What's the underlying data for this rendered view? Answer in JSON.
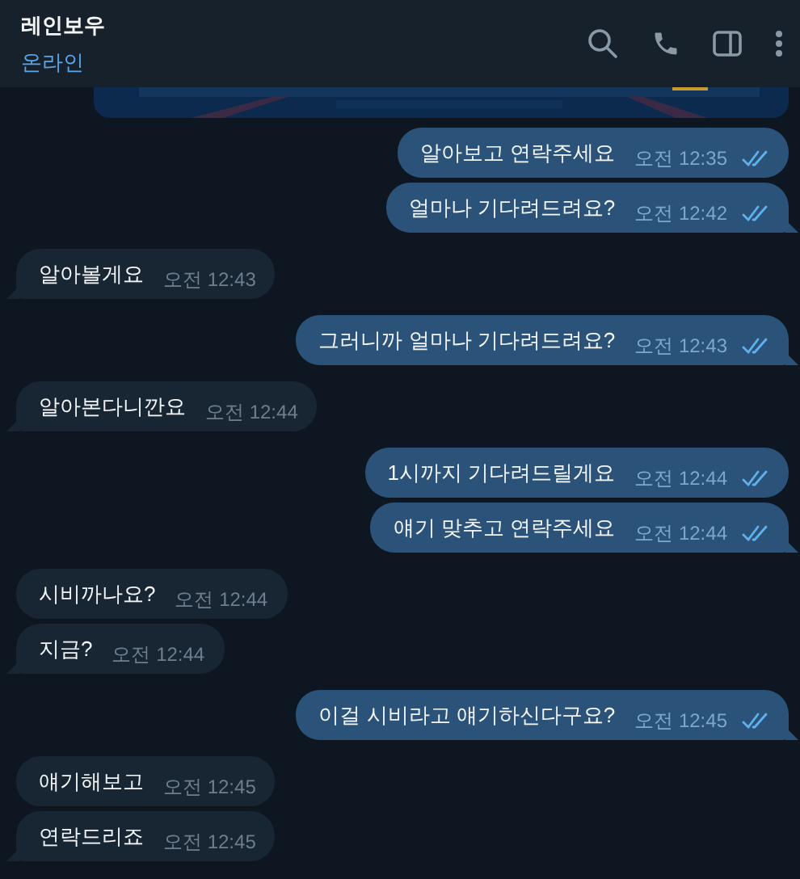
{
  "chat": {
    "title": "레인보우",
    "status": "온라인"
  },
  "messages": [
    {
      "kind": "out",
      "text": "알아보고 연락주세요",
      "time": "오전 12:35",
      "read": true
    },
    {
      "kind": "out",
      "text": "얼마나 기다려드려요?",
      "time": "오전 12:42",
      "read": true
    },
    {
      "kind": "in",
      "text": "알아볼게요",
      "time": "오전 12:43"
    },
    {
      "kind": "out",
      "text": "그러니까 얼마나 기다려드려요?",
      "time": "오전 12:43",
      "read": true
    },
    {
      "kind": "in",
      "text": "알아본다니깐요",
      "time": "오전 12:44"
    },
    {
      "kind": "out",
      "text": "1시까지 기다려드릴게요",
      "time": "오전 12:44",
      "read": true
    },
    {
      "kind": "out",
      "text": "얘기 맞추고 연락주세요",
      "time": "오전 12:44",
      "read": true
    },
    {
      "kind": "in",
      "text": "시비까나요?",
      "time": "오전 12:44"
    },
    {
      "kind": "in",
      "text": "지금?",
      "time": "오전 12:44"
    },
    {
      "kind": "out",
      "text": "이걸 시비라고 얘기하신다구요?",
      "time": "오전 12:45",
      "read": true
    },
    {
      "kind": "in",
      "text": "얘기해보고",
      "time": "오전 12:45"
    },
    {
      "kind": "in",
      "text": "연락드리죠",
      "time": "오전 12:45"
    }
  ]
}
